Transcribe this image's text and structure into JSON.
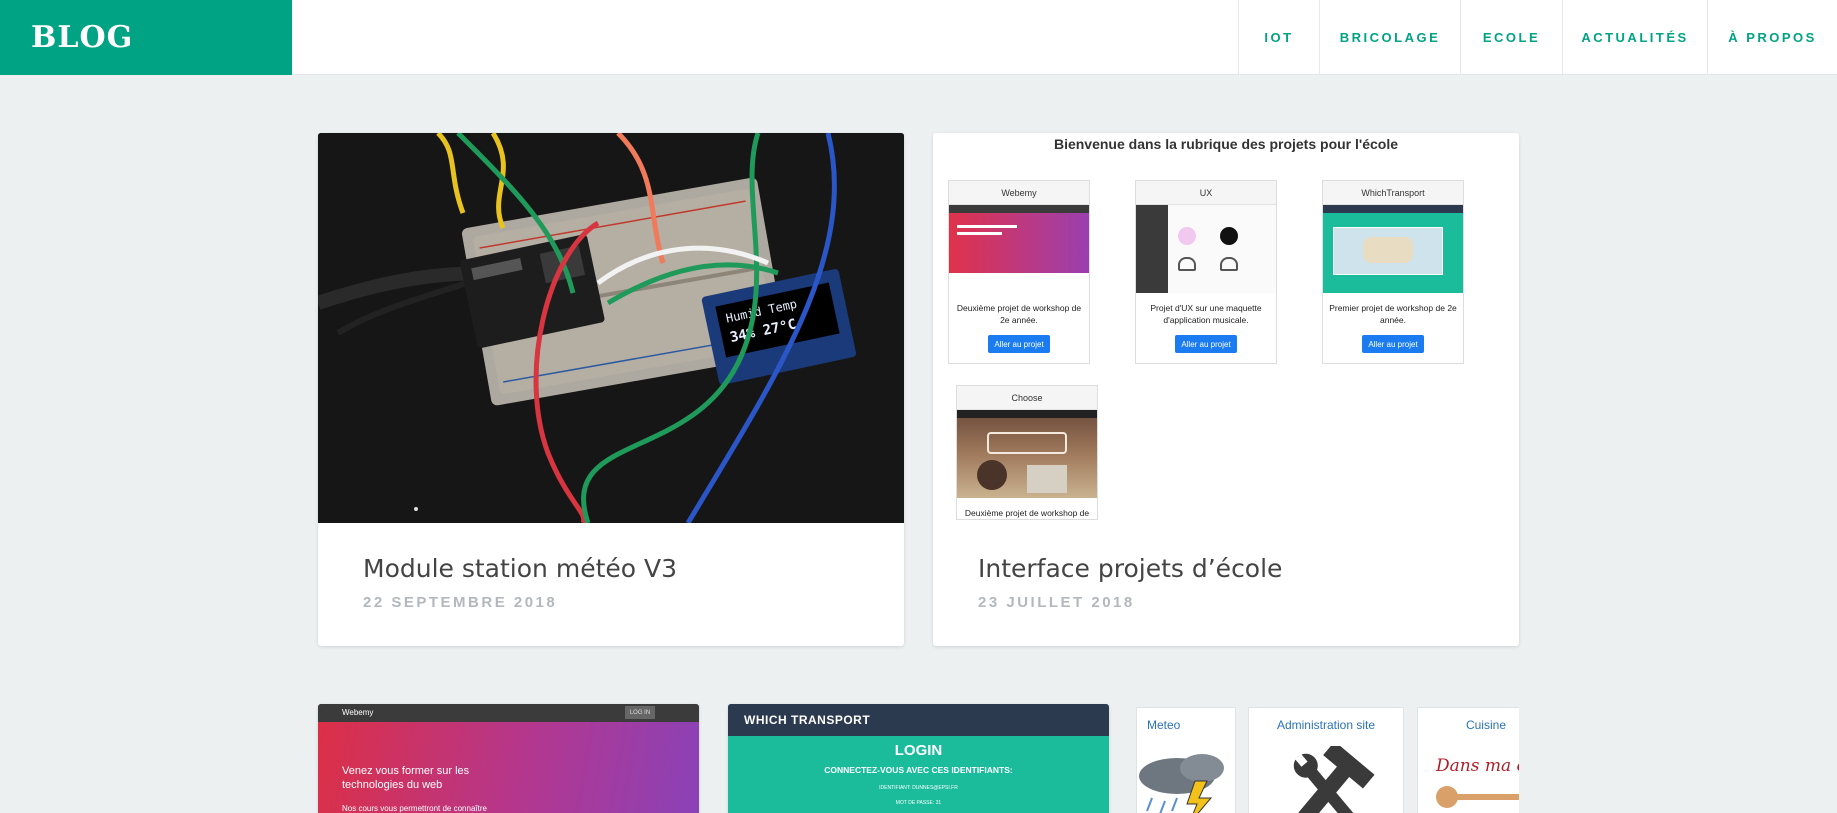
{
  "brand": "BLOG",
  "nav": [
    "IOT",
    "BRICOLAGE",
    "ECOLE",
    "ACTUALITÉS",
    "À PROPOS"
  ],
  "posts": [
    {
      "title": "Module station météo V3",
      "date": "22 SEPTEMBRE 2018"
    },
    {
      "title": "Interface projets d’école",
      "date": "23 JUILLET 2018"
    }
  ],
  "school_shot": {
    "heading": "Bienvenue dans la rubrique des projets pour l'école",
    "projects": [
      {
        "name": "Webemy",
        "text": "Deuxième projet de workshop de 2e année.",
        "button": "Aller au projet"
      },
      {
        "name": "UX",
        "text": "Projet d'UX sur une maquette d'application musicale.",
        "button": "Aller au projet"
      },
      {
        "name": "WhichTransport",
        "text": "Premier projet de workshop de 2e année.",
        "button": "Aller au projet"
      },
      {
        "name": "Choose",
        "text": "Deuxième projet de workshop de"
      }
    ]
  },
  "oled": {
    "line1": "Humid  Temp",
    "line2": "34%  27°C"
  },
  "bottom": {
    "webemy": {
      "brand": "Webemy",
      "login": "LOG IN",
      "heading": "Venez vous former sur les technologies du web",
      "sub": "Nos cours vous permettront de connaître"
    },
    "whichtransport": {
      "bar": "WHICH TRANSPORT",
      "title": "LOGIN",
      "subtitle": "CONNECTEZ-VOUS AVEC CES IDENTIFIANTS:",
      "id_line": "IDENTIFIANT: DUNNES@EPSI.FR",
      "pass_line": "MOT DE PASSE: 31"
    },
    "tiles": [
      "Meteo",
      "Administration site",
      "Cuisine"
    ],
    "tile_script": "Dans ma c"
  },
  "colors": {
    "accent": "#00a383",
    "background": "#ecf0f1",
    "button_blue": "#1a7cf0"
  }
}
